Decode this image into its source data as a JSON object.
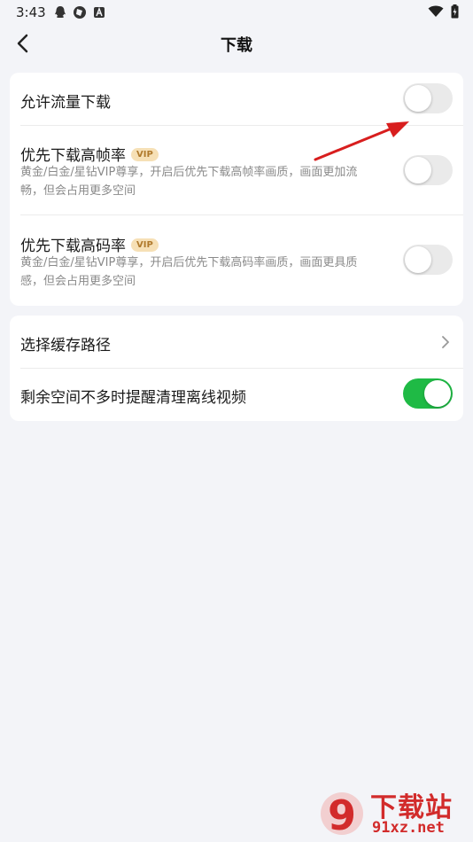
{
  "status_bar": {
    "time": "3:43",
    "left_icons": [
      "qq-icon",
      "app-icon",
      "text-a-icon"
    ],
    "right_icons": [
      "wifi-icon",
      "battery-icon"
    ]
  },
  "header": {
    "title": "下载"
  },
  "settings": {
    "allow_mobile_download": {
      "label": "允许流量下载",
      "enabled": false
    },
    "high_fps": {
      "label": "优先下载高帧率",
      "badge": "VIP",
      "desc_line1": "黄金/白金/星钻VIP尊享，开启后优先下载高帧率画质，画面更加流",
      "desc_line2": "畅，但会占用更多空间",
      "enabled": false
    },
    "high_bitrate": {
      "label": "优先下载高码率",
      "badge": "VIP",
      "desc_line1": "黄金/白金/星钻VIP尊享，开启后优先下载高码率画质，画面更具质",
      "desc_line2": "感，但会占用更多空间",
      "enabled": false
    },
    "cache_path": {
      "label": "选择缓存路径"
    },
    "low_space_reminder": {
      "label": "剩余空间不多时提醒清理离线视频",
      "enabled": true
    }
  },
  "colors": {
    "toggle_on": "#1fba45",
    "toggle_off": "#eaeaea",
    "annotation_arrow": "#d81e1e",
    "vip_badge_bg": "#f6e0b6",
    "vip_badge_text": "#b07a2c"
  },
  "watermark": {
    "title": "下载站",
    "url": "91xz.net",
    "logo_text": "9"
  }
}
